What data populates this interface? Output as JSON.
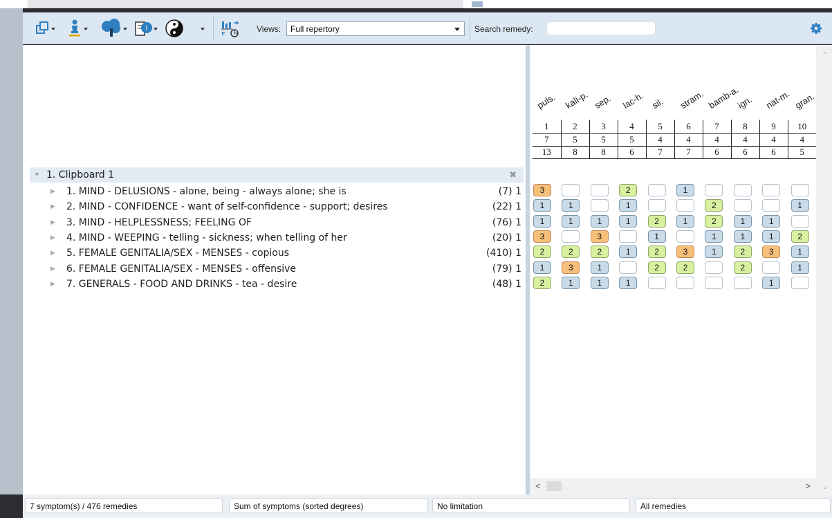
{
  "toolbar": {
    "views_label": "Views:",
    "views_value": "Full repertory",
    "search_label": "Search remedy:",
    "search_value": ""
  },
  "clipboard": {
    "title": "1. Clipboard 1"
  },
  "symptoms": [
    {
      "text": "1. MIND - DELUSIONS - alone, being - always alone; she is",
      "count": "(7) 1"
    },
    {
      "text": "2. MIND - CONFIDENCE - want of self-confidence - support; desires",
      "count": "(22) 1"
    },
    {
      "text": "3. MIND - HELPLESSNESS; FEELING OF",
      "count": "(76) 1"
    },
    {
      "text": "4. MIND - WEEPING - telling - sickness; when telling of her",
      "count": "(20) 1"
    },
    {
      "text": "5. FEMALE GENITALIA/SEX - MENSES - copious",
      "count": "(410) 1"
    },
    {
      "text": "6. FEMALE GENITALIA/SEX - MENSES - offensive",
      "count": "(79) 1"
    },
    {
      "text": "7. GENERALS - FOOD AND DRINKS - tea - desire",
      "count": "(48) 1"
    }
  ],
  "remedies": [
    "puls.",
    "kali-p.",
    "sep.",
    "lac-h.",
    "sil.",
    "stram.",
    "bamb-a.",
    "ign.",
    "nat-m.",
    "gran."
  ],
  "rank_row": [
    "1",
    "2",
    "3",
    "4",
    "5",
    "6",
    "7",
    "8",
    "9",
    "10"
  ],
  "count_row": [
    "7",
    "5",
    "5",
    "5",
    "4",
    "4",
    "4",
    "4",
    "4",
    "4"
  ],
  "score_row": [
    "13",
    "8",
    "8",
    "6",
    "7",
    "7",
    "6",
    "6",
    "6",
    "5"
  ],
  "grid": [
    [
      3,
      0,
      0,
      2,
      0,
      1,
      0,
      0,
      0,
      0
    ],
    [
      1,
      1,
      0,
      1,
      0,
      0,
      2,
      0,
      0,
      1
    ],
    [
      1,
      1,
      1,
      1,
      2,
      1,
      2,
      1,
      1,
      0
    ],
    [
      3,
      0,
      3,
      0,
      1,
      0,
      1,
      1,
      1,
      2
    ],
    [
      2,
      2,
      2,
      1,
      2,
      3,
      1,
      2,
      3,
      1
    ],
    [
      1,
      3,
      1,
      0,
      2,
      2,
      0,
      2,
      0,
      1
    ],
    [
      2,
      1,
      1,
      1,
      0,
      0,
      0,
      0,
      1,
      0
    ]
  ],
  "grade_colors": {
    "1": "#c9dbe8",
    "2": "#d9f0a0",
    "3": "#f6c07b"
  },
  "status": {
    "symptoms_remedies": "7 symptom(s) / 476 remedies",
    "sort": "Sum of symptoms (sorted degrees)",
    "limitation": "No limitation",
    "remedy_filter": "All remedies"
  }
}
